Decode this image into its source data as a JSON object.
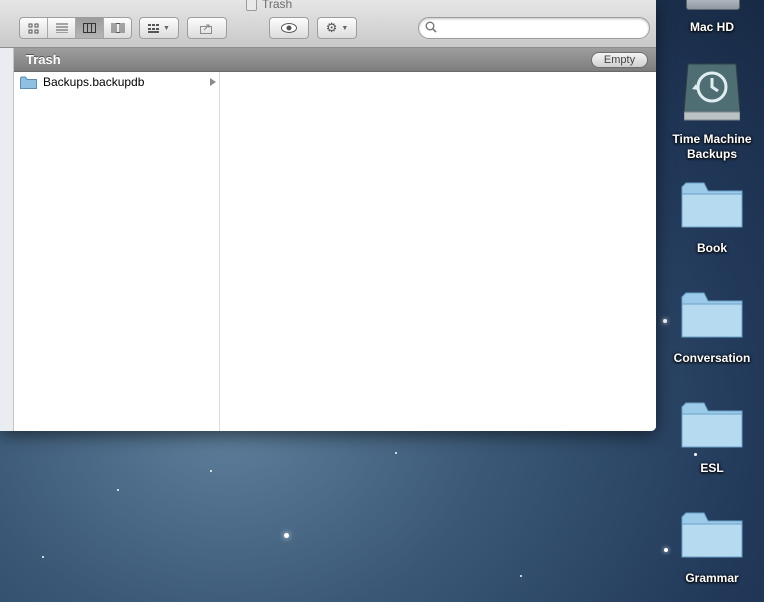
{
  "window": {
    "title": "Trash",
    "header_title": "Trash",
    "empty_label": "Empty"
  },
  "toolbar": {
    "view_buttons": [
      "icon-view-icon",
      "list-view-icon",
      "column-view-icon",
      "coverflow-view-icon"
    ],
    "active_view": "column-view-icon",
    "search_placeholder": ""
  },
  "column1": {
    "items": [
      {
        "label": "Backups.backupdb",
        "icon": "folder-icon"
      }
    ]
  },
  "desktop": {
    "items": [
      {
        "label": "Mac HD",
        "icon": "hard-drive-icon"
      },
      {
        "label": "Time Machine Backups",
        "icon": "time-machine-icon"
      },
      {
        "label": "Book",
        "icon": "folder-icon"
      },
      {
        "label": "Conversation",
        "icon": "folder-icon"
      },
      {
        "label": "ESL",
        "icon": "folder-icon"
      },
      {
        "label": "Grammar",
        "icon": "folder-icon"
      }
    ]
  },
  "colors": {
    "header_bar": "#8e8e8e",
    "folder_blue": "#8fc0e2",
    "desktop_blue": "#2f4d6e"
  }
}
